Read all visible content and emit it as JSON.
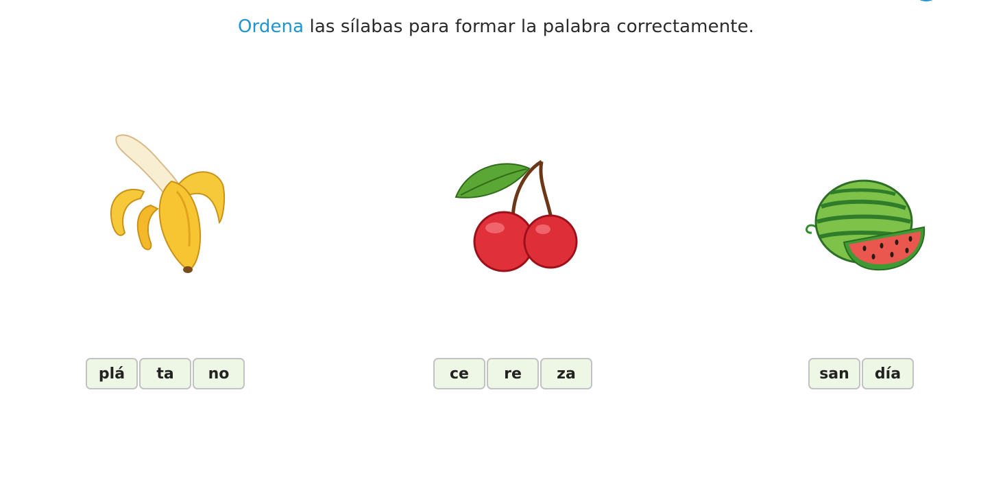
{
  "instruction": {
    "highlight": "Ordena",
    "rest": " las sílabas para formar la palabra correctamente."
  },
  "colors": {
    "accent": "#1e95d3",
    "tile_background": "#eef7e5",
    "tile_border": "#c2c2c2"
  },
  "exercises": [
    {
      "icon": "banana-icon",
      "syllables": [
        "plá",
        "ta",
        "no"
      ]
    },
    {
      "icon": "cherry-icon",
      "syllables": [
        "ce",
        "re",
        "za"
      ]
    },
    {
      "icon": "watermelon-icon",
      "syllables": [
        "san",
        "día"
      ]
    }
  ]
}
